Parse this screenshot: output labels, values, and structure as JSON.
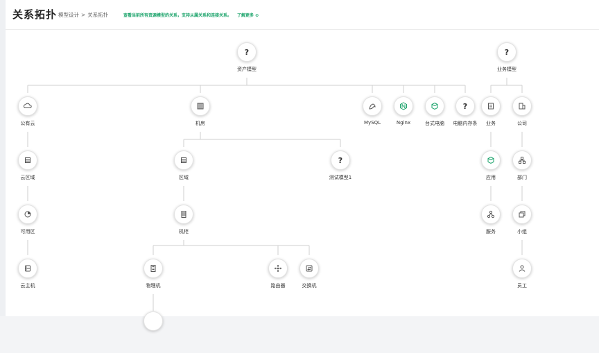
{
  "header": {
    "title": "关系拓扑",
    "breadcrumb": [
      "模型设计",
      "关系拓扑"
    ],
    "breadcrumb_sep": ">",
    "hint": "查看当前所有资源模型的关系，支持从属关系和连接关系。",
    "hint_link": "了解更多 ⊙"
  },
  "nodes": {
    "asset_model": {
      "label": "资产模型",
      "icon": "question-icon"
    },
    "business_model": {
      "label": "业务模型",
      "icon": "question-icon"
    },
    "public_cloud": {
      "label": "公有云",
      "icon": "cloud-icon"
    },
    "machine_room": {
      "label": "机房",
      "icon": "building-icon"
    },
    "mysql": {
      "label": "MySQL",
      "icon": "mysql-icon"
    },
    "nginx": {
      "label": "Nginx",
      "icon": "nginx-icon"
    },
    "desktop": {
      "label": "台式电脑",
      "icon": "box-icon"
    },
    "pc_memory": {
      "label": "电脑内存条",
      "icon": "question-icon"
    },
    "business": {
      "label": "业务",
      "icon": "business-icon"
    },
    "company": {
      "label": "公司",
      "icon": "company-icon"
    },
    "cloud_region": {
      "label": "云区域",
      "icon": "grid-icon"
    },
    "region": {
      "label": "区域",
      "icon": "grid-icon"
    },
    "test_model": {
      "label": "测试模型1",
      "icon": "question-icon"
    },
    "app": {
      "label": "应用",
      "icon": "cube-icon"
    },
    "department": {
      "label": "部门",
      "icon": "org-icon"
    },
    "availability_zone": {
      "label": "可用区",
      "icon": "pie-icon"
    },
    "cabinet": {
      "label": "机柜",
      "icon": "cabinet-icon"
    },
    "service": {
      "label": "服务",
      "icon": "service-icon"
    },
    "group": {
      "label": "小组",
      "icon": "group-icon"
    },
    "cloud_host": {
      "label": "云主机",
      "icon": "host-icon"
    },
    "physical_machine": {
      "label": "物理机",
      "icon": "server-icon"
    },
    "router": {
      "label": "路由器",
      "icon": "router-icon"
    },
    "switch": {
      "label": "交换机",
      "icon": "switch-icon"
    },
    "employee": {
      "label": "员工",
      "icon": "user-icon"
    }
  },
  "colors": {
    "accent": "#1aa36a",
    "line": "#cfcfcf"
  }
}
